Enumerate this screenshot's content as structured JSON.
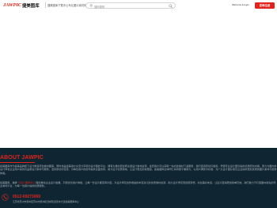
{
  "header": {
    "logo_en": "JAWPIC",
    "logo_cn": "捷美图库",
    "slogan": "捷美图库下载中心专业图片素材库",
    "search_placeholder": "搜你想的",
    "welcome": "Welcome & login",
    "consult_label": "咨询/注册"
  },
  "about": {
    "title": "ABOUT JAWPIC",
    "paragraph1": "捷美图库作为捷美品牌旗下设计类目原创素材图库，同时也是捷美用户交流分享原创设计图的平台，拥有大量的原创商业级设计素材资源，会员用户可以获取一站式的素材下载服务，我们坚持原创与版权，凭借专业设计团队提供优质原创内容，努力为国内外设计师和企业用户提供高品质设计素材与服务，坚持原创价值观，为每位用户的创作提供全面支持，助力设计创意落地，让设计更加高效便捷，捷美图库全体同仁将持续不懈努力，以用户满意为标准，为广大设计爱好者及企业提供更加优质的图片素材与服务体验。",
    "p2_before": "捷美图库，秉承“",
    "p2_highlight": "为设计图库中心",
    "p2_after": "”理念推动企业设计发展，不断优化用户体验，让每一份设计都富有价值，为设计师及创作者提供丰富多元的优质素材资源，助力设计师实现创意梦想，共创美好未来，让设计变得更加简单高效，我们致力于打造国内领先的专业素材平台，为每一位用户提供优质服务。"
  },
  "contact": {
    "phone": "0512-69273069",
    "address": "江苏省苏州市吴中区苏州市吴中区长桥街道吴中大道捷美图库中心"
  },
  "colors": {
    "brand_red": "#e0241b",
    "footer_bg": "#0f2632"
  }
}
